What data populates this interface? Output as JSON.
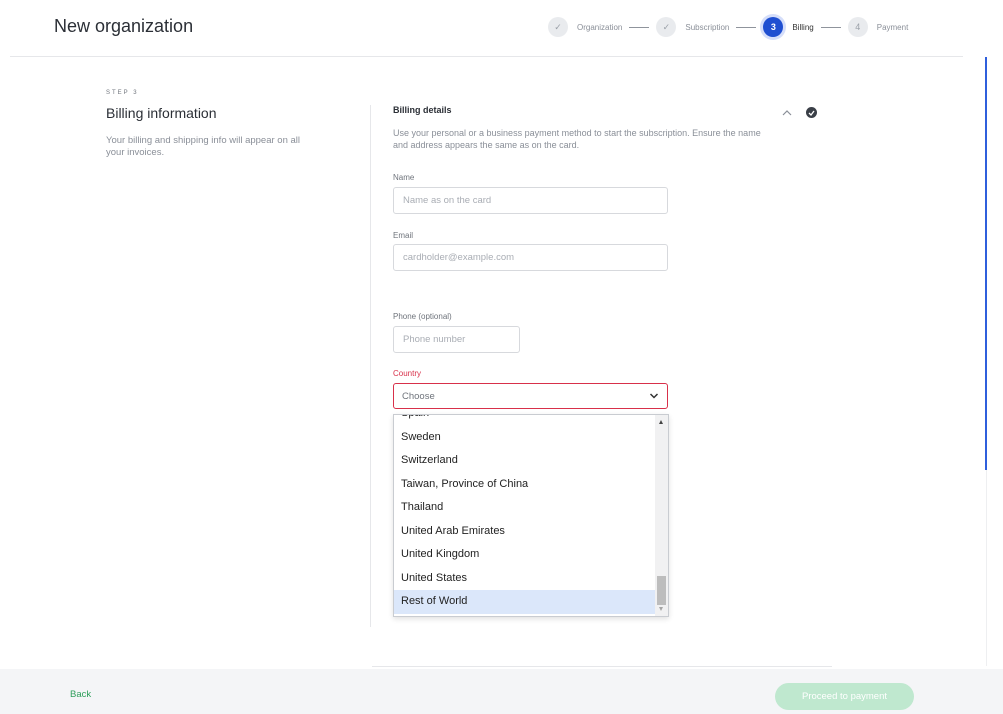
{
  "header": {
    "title": "New organization",
    "steps": [
      {
        "marker": "✓",
        "label": "Organization",
        "state": "done"
      },
      {
        "marker": "✓",
        "label": "Subscription",
        "state": "done"
      },
      {
        "marker": "3",
        "label": "Billing",
        "state": "active"
      },
      {
        "marker": "4",
        "label": "Payment",
        "state": "upcoming"
      }
    ]
  },
  "intro": {
    "step_label": "STEP 3",
    "title": "Billing information",
    "description": "Your billing and shipping info will appear on all your invoices."
  },
  "billing": {
    "title": "Billing details",
    "description": "Use your personal or a business payment method to start the subscription. Ensure the name and address appears the same as on the card.",
    "name": {
      "label": "Name",
      "placeholder": "Name as on the card",
      "value": ""
    },
    "email": {
      "label": "Email",
      "placeholder": "cardholder@example.com",
      "value": ""
    },
    "phone": {
      "label": "Phone (optional)",
      "placeholder": "Phone number",
      "value": ""
    },
    "country": {
      "label": "Country",
      "selected": "Choose",
      "options": [
        "Spain",
        "Sweden",
        "Switzerland",
        "Taiwan, Province of China",
        "Thailand",
        "United Arab Emirates",
        "United Kingdom",
        "United States",
        "Rest of World"
      ],
      "highlighted": "Rest of World"
    }
  },
  "footer": {
    "back_label": "Back",
    "proceed_label": "Proceed to payment"
  },
  "colors": {
    "accent": "#1f4fd1",
    "error": "#d8304a",
    "success": "#2e9e5b",
    "button_disabled": "#bfe8cf",
    "option_highlight": "#dbe7fa"
  }
}
